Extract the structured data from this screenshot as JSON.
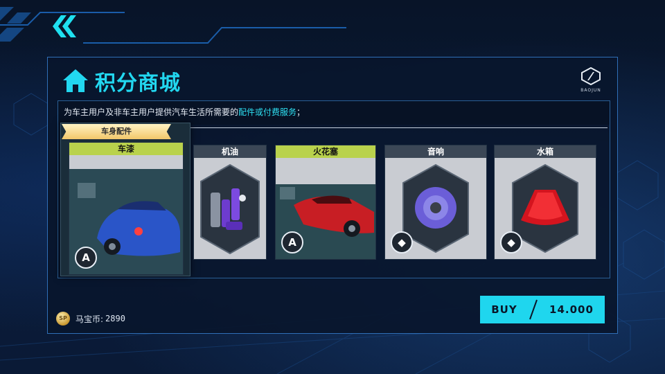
{
  "header": {
    "back_icon": "double-chevron-left-icon",
    "accent": "#1fe0f0"
  },
  "panel": {
    "title": "积分商城",
    "home_icon": "home-icon",
    "brand_icon": "baojun-logo-icon",
    "brand_text": "BAOJUN"
  },
  "description": {
    "text": "为车主用户及非车主用户提供汽车生活所需要的",
    "highlight": "配件或付费服务",
    "suffix": "；"
  },
  "category_ribbon": "车身配件",
  "cards": [
    {
      "label": "车漆",
      "style": "lime",
      "image": "blue-car",
      "badge_icon": "alpha-badge-icon",
      "badge_text": "A"
    },
    {
      "label": "机油",
      "style": "dark",
      "image": "oil-bottles",
      "badge_icon": "",
      "badge_text": ""
    },
    {
      "label": "火花塞",
      "style": "lime",
      "image": "red-car",
      "badge_icon": "alpha-badge-icon",
      "badge_text": "A"
    },
    {
      "label": "音响",
      "style": "dark",
      "image": "speaker",
      "badge_icon": "shield-badge-icon",
      "badge_text": "◆"
    },
    {
      "label": "水箱",
      "style": "dark",
      "image": "radiator",
      "badge_icon": "shield-badge-icon",
      "badge_text": "◆"
    }
  ],
  "wallet": {
    "coin_icon": "sp-coin-icon",
    "coin_text": "SP",
    "label": "马宝币:",
    "value": "2890"
  },
  "buy": {
    "label": "BUY",
    "price": "14.000"
  }
}
